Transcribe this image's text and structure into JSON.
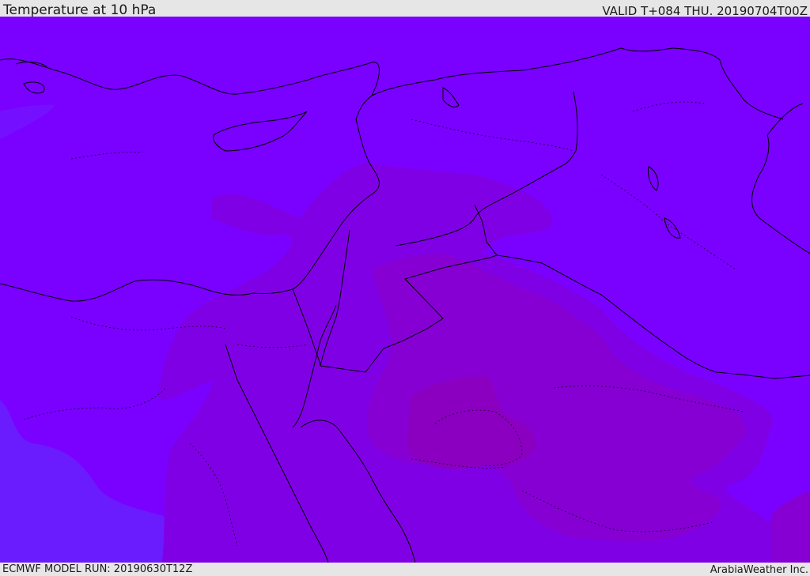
{
  "header": {
    "title": "Temperature at 10 hPa",
    "valid": "VALID T+084 THU. 20190704T00Z"
  },
  "footer": {
    "model_run": "ECMWF MODEL RUN: 20190630T12Z",
    "credit": "ArabiaWeather Inc."
  },
  "map": {
    "colors": {
      "background": "#7a00ff",
      "cool_band": "#6a1cff",
      "warm_band_1": "#7f00e8",
      "warm_band_2": "#8400d8",
      "warm_core": "#8a00c4",
      "border": "#000000"
    }
  }
}
